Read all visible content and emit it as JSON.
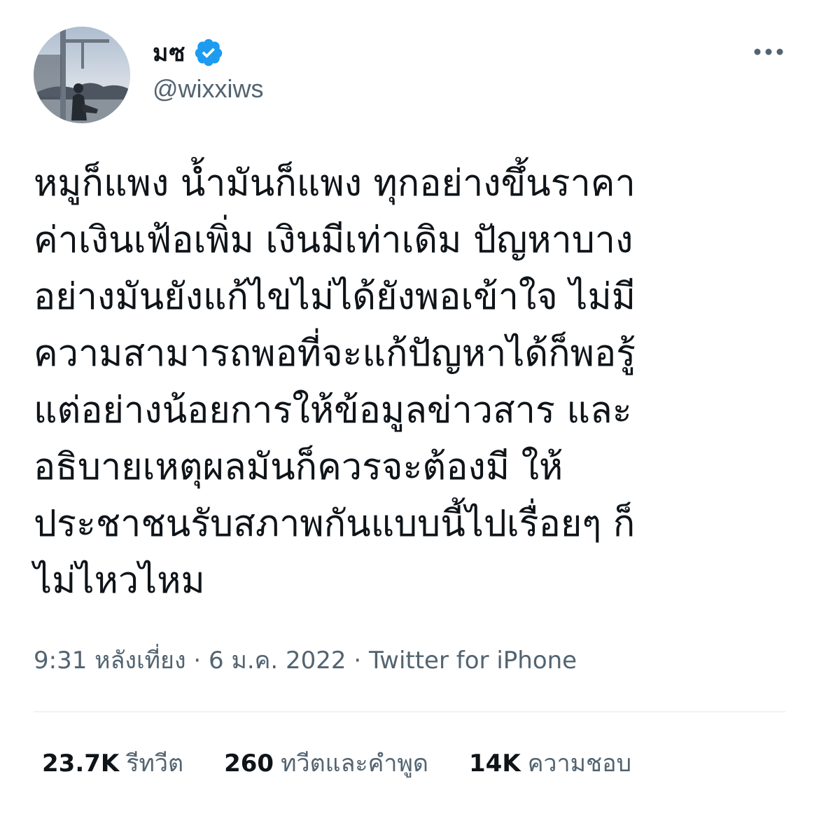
{
  "user": {
    "display_name": "มซ",
    "handle": "@wixxiws",
    "verified": true,
    "verified_color": "#1d9bf0"
  },
  "menu": {
    "more_icon": "more-horizontal-icon"
  },
  "tweet": {
    "lines": [
      "หมูก็แพง น้ำมันก็แพง ทุกอย่างขึ้นราคา",
      "ค่าเงินเฟ้อเพิ่ม เงินมีเท่าเดิม ปัญหาบาง",
      "อย่างมันยังแก้ไขไม่ได้ยังพอเข้าใจ ไม่มี",
      "ความสามารถพอที่จะแก้ปัญหาได้ก็พอรู้",
      "แต่อย่างน้อยการให้ข้อมูลข่าวสาร และ",
      "อธิบายเหตุผลมันก็ควรจะต้องมี ให้",
      "ประชาชนรับสภาพกันแบบนี้ไปเรื่อยๆ ก็",
      "ไม่ไหวไหม"
    ],
    "time": "9:31 หลังเที่ยง",
    "date": "6 ม.ค. 2022",
    "separator": "·",
    "source": "Twitter for iPhone"
  },
  "stats": {
    "retweets": {
      "count": "23.7K",
      "label": "รีทวีต"
    },
    "quotes": {
      "count": "260",
      "label": "ทวีตและคำพูด"
    },
    "likes": {
      "count": "14K",
      "label": "ความชอบ"
    }
  },
  "colors": {
    "text_primary": "#0f1419",
    "text_secondary": "#536471",
    "divider": "#eff3f4"
  }
}
